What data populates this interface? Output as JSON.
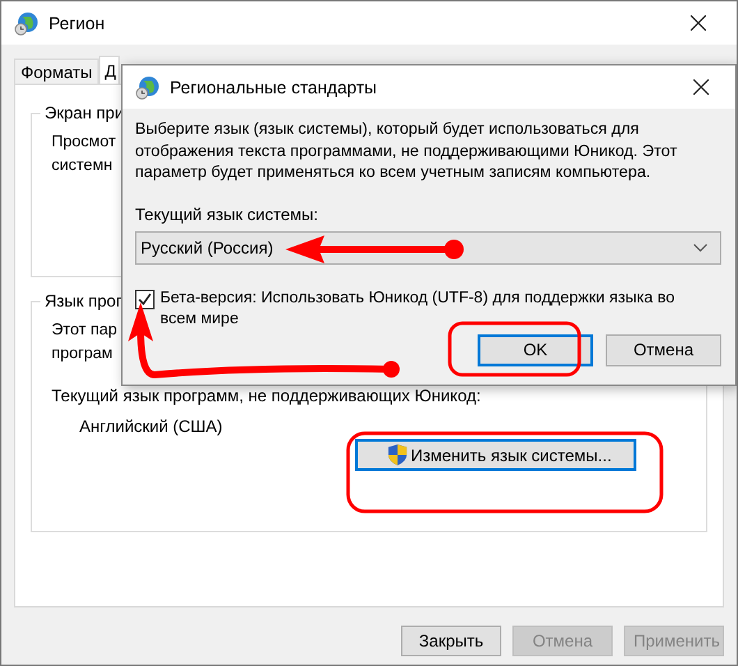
{
  "window": {
    "title": "Регион"
  },
  "tabs": [
    {
      "label": "Форматы",
      "selected": false
    },
    {
      "label": "Д",
      "selected": true
    }
  ],
  "display_group": {
    "title": "Экран при",
    "lines": [
      "Просмот",
      "системн"
    ]
  },
  "language_group": {
    "title": "Язык прог",
    "lines": [
      "Этот пар",
      "програм"
    ],
    "current_label": "Текущий язык программ, не поддерживающих Юникод:",
    "current_value": "Английский (США)",
    "change_button": "Изменить язык системы..."
  },
  "buttons": [
    {
      "label": "Закрыть",
      "disabled": false
    },
    {
      "label": "Отмена",
      "disabled": true
    },
    {
      "label": "Применить",
      "disabled": true
    }
  ],
  "dialog": {
    "title": "Региональные стандарты",
    "description": "Выберите язык (язык системы), который будет использоваться для отображения текста программами, не поддерживающими Юникод. Этот параметр будет применяться ко всем учетным записям компьютера.",
    "system_language_label": "Текущий язык системы:",
    "dropdown_value": "Русский (Россия)",
    "beta_checkbox": {
      "label": "Бета-версия: Использовать Юникод (UTF-8) для поддержки языка во всем мире",
      "checked": true
    },
    "buttons": [
      {
        "label": "OK",
        "default": true
      },
      {
        "label": "Отмена",
        "default": false
      }
    ]
  }
}
